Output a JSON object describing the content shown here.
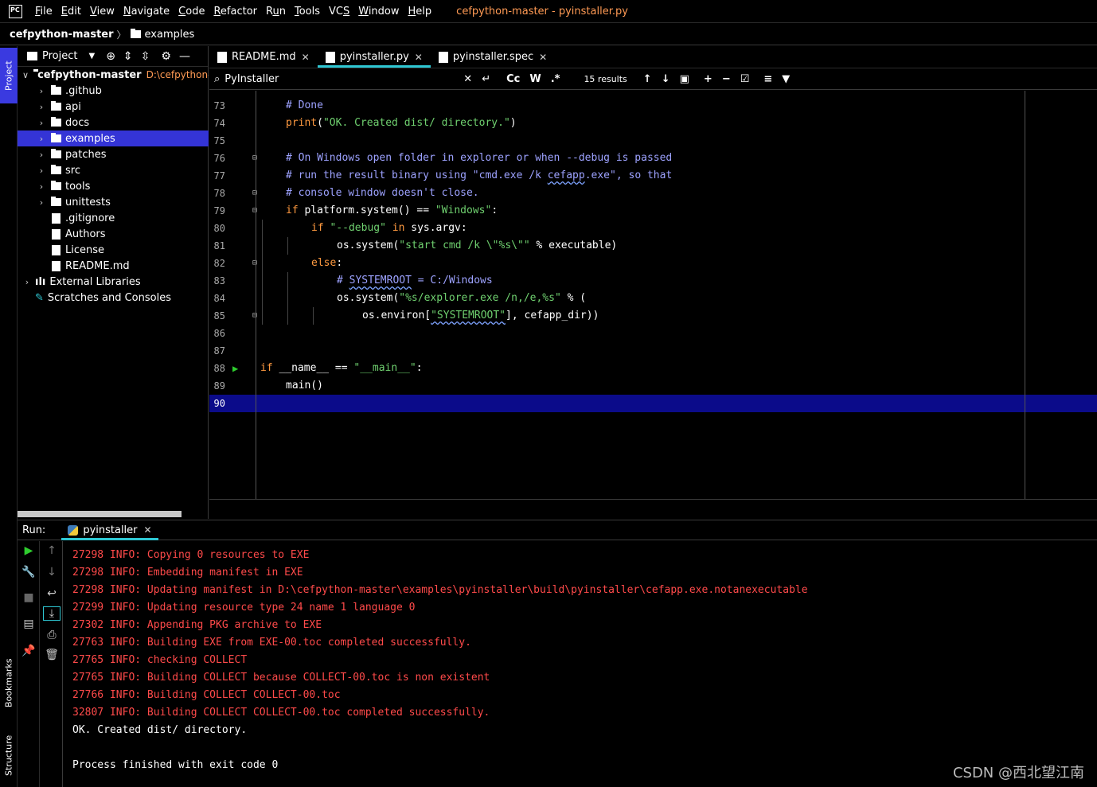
{
  "menubar": {
    "logo": "PC",
    "items": [
      {
        "pre": "",
        "u": "F",
        "post": "ile"
      },
      {
        "pre": "",
        "u": "E",
        "post": "dit"
      },
      {
        "pre": "",
        "u": "V",
        "post": "iew"
      },
      {
        "pre": "",
        "u": "N",
        "post": "avigate"
      },
      {
        "pre": "",
        "u": "C",
        "post": "ode"
      },
      {
        "pre": "",
        "u": "R",
        "post": "efactor"
      },
      {
        "pre": "R",
        "u": "u",
        "post": "n"
      },
      {
        "pre": "",
        "u": "T",
        "post": "ools"
      },
      {
        "pre": "VC",
        "u": "S",
        "post": ""
      },
      {
        "pre": "",
        "u": "W",
        "post": "indow"
      },
      {
        "pre": "",
        "u": "H",
        "post": "elp"
      }
    ],
    "window_title": "cefpython-master - pyinstaller.py"
  },
  "breadcrumb": {
    "root": "cefpython-master",
    "sep": "〉",
    "folder": "examples"
  },
  "left_strip": {
    "project_tab": "Project",
    "bookmarks_tab": "Bookmarks",
    "structure_tab": "Structure"
  },
  "project": {
    "label": "Project",
    "tree": [
      {
        "label": "cefpython-master",
        "path": "D:\\cefpython-m",
        "indent": 0,
        "chev": "∨",
        "type": "folder",
        "bold": true
      },
      {
        "label": ".github",
        "indent": 1,
        "chev": "›",
        "type": "folder"
      },
      {
        "label": "api",
        "indent": 1,
        "chev": "›",
        "type": "folder"
      },
      {
        "label": "docs",
        "indent": 1,
        "chev": "›",
        "type": "folder"
      },
      {
        "label": "examples",
        "indent": 1,
        "chev": "›",
        "type": "folder",
        "selected": true
      },
      {
        "label": "patches",
        "indent": 1,
        "chev": "›",
        "type": "folder"
      },
      {
        "label": "src",
        "indent": 1,
        "chev": "›",
        "type": "folder"
      },
      {
        "label": "tools",
        "indent": 1,
        "chev": "›",
        "type": "folder"
      },
      {
        "label": "unittests",
        "indent": 1,
        "chev": "›",
        "type": "folder"
      },
      {
        "label": ".gitignore",
        "indent": 1,
        "chev": "",
        "type": "file"
      },
      {
        "label": "Authors",
        "indent": 1,
        "chev": "",
        "type": "file"
      },
      {
        "label": "License",
        "indent": 1,
        "chev": "",
        "type": "file"
      },
      {
        "label": "README.md",
        "indent": 1,
        "chev": "",
        "type": "file"
      },
      {
        "label": "External Libraries",
        "indent": 0,
        "chev": "›",
        "type": "lib"
      },
      {
        "label": "Scratches and Consoles",
        "indent": 0,
        "chev": "",
        "type": "scratch"
      }
    ]
  },
  "tabs": [
    {
      "label": "README.md",
      "active": false
    },
    {
      "label": "pyinstaller.py",
      "active": true
    },
    {
      "label": "pyinstaller.spec",
      "active": false
    }
  ],
  "find": {
    "query": "PyInstaller",
    "case_label": "Cc",
    "word_label": "W",
    "regex_label": ".*",
    "results": "15 results"
  },
  "editor": {
    "current_line": "90",
    "lines": [
      {
        "n": "73",
        "indent": 1,
        "parts": [
          [
            "cm",
            "# Done"
          ]
        ]
      },
      {
        "n": "74",
        "indent": 1,
        "parts": [
          [
            "kw",
            "print"
          ],
          [
            "fn",
            "("
          ],
          [
            "str",
            "\"OK. Created dist/ directory.\""
          ],
          [
            "fn",
            ")"
          ]
        ]
      },
      {
        "n": "75",
        "indent": 0,
        "parts": []
      },
      {
        "n": "76",
        "indent": 1,
        "fold": "⌃",
        "parts": [
          [
            "cm",
            "# On Windows open folder in explorer or when --debug is passed"
          ]
        ]
      },
      {
        "n": "77",
        "indent": 1,
        "parts": [
          [
            "cm",
            "# run the result binary using \"cmd.exe /k "
          ],
          [
            "cmw",
            "cefapp"
          ],
          [
            "cm",
            ".exe\", so that"
          ]
        ]
      },
      {
        "n": "78",
        "indent": 1,
        "fold": "⌄",
        "parts": [
          [
            "cm",
            "# console window doesn't close."
          ]
        ]
      },
      {
        "n": "79",
        "indent": 1,
        "fold": "⌃",
        "parts": [
          [
            "kw",
            "if "
          ],
          [
            "fn",
            "platform.system() == "
          ],
          [
            "str",
            "\"Windows\""
          ],
          [
            "fn",
            ":"
          ]
        ]
      },
      {
        "n": "80",
        "indent": 2,
        "parts": [
          [
            "kw",
            "if "
          ],
          [
            "str",
            "\"--debug\""
          ],
          [
            "kw",
            " in "
          ],
          [
            "fn",
            "sys.argv:"
          ]
        ]
      },
      {
        "n": "81",
        "indent": 3,
        "parts": [
          [
            "fn",
            "os.system("
          ],
          [
            "str",
            "\"start cmd /k \\\"%s\\\"\""
          ],
          [
            "fn",
            " % executable)"
          ]
        ]
      },
      {
        "n": "82",
        "indent": 2,
        "fold": "⌃",
        "parts": [
          [
            "kw",
            "else"
          ],
          [
            "fn",
            ":"
          ]
        ]
      },
      {
        "n": "83",
        "indent": 3,
        "parts": [
          [
            "cm",
            "# "
          ],
          [
            "cmw",
            "SYSTEMROOT"
          ],
          [
            "cm",
            " = C:/Windows"
          ]
        ]
      },
      {
        "n": "84",
        "indent": 3,
        "parts": [
          [
            "fn",
            "os.system("
          ],
          [
            "str",
            "\"%s/explorer.exe /n,/e,%s\""
          ],
          [
            "fn",
            " % ("
          ]
        ]
      },
      {
        "n": "85",
        "indent": 4,
        "fold": "⌄",
        "parts": [
          [
            "fn",
            "os.environ["
          ],
          [
            "strw",
            "\"SYSTEMROOT\""
          ],
          [
            "fn",
            "], cefapp_dir))"
          ]
        ]
      },
      {
        "n": "86",
        "indent": 0,
        "parts": []
      },
      {
        "n": "87",
        "indent": 0,
        "parts": []
      },
      {
        "n": "88",
        "indent": 0,
        "run": true,
        "parts": [
          [
            "kw",
            "if "
          ],
          [
            "fn",
            "__name__ == "
          ],
          [
            "str",
            "\"__main__\""
          ],
          [
            "fn",
            ":"
          ]
        ]
      },
      {
        "n": "89",
        "indent": 1,
        "parts": [
          [
            "fn",
            "main()"
          ]
        ]
      },
      {
        "n": "90",
        "indent": 0,
        "parts": []
      }
    ]
  },
  "run": {
    "label": "Run:",
    "tab": "pyinstaller",
    "console": [
      {
        "kind": "err",
        "text": "27298 INFO: Copying 0 resources to EXE"
      },
      {
        "kind": "err",
        "text": "27298 INFO: Embedding manifest in EXE"
      },
      {
        "kind": "err",
        "text": "27298 INFO: Updating manifest in D:\\cefpython-master\\examples\\pyinstaller\\build\\pyinstaller\\cefapp.exe.notanexecutable"
      },
      {
        "kind": "err",
        "text": "27299 INFO: Updating resource type 24 name 1 language 0"
      },
      {
        "kind": "err",
        "text": "27302 INFO: Appending PKG archive to EXE"
      },
      {
        "kind": "err",
        "text": "27763 INFO: Building EXE from EXE-00.toc completed successfully."
      },
      {
        "kind": "err",
        "text": "27765 INFO: checking COLLECT"
      },
      {
        "kind": "err",
        "text": "27765 INFO: Building COLLECT because COLLECT-00.toc is non existent"
      },
      {
        "kind": "err",
        "text": "27766 INFO: Building COLLECT COLLECT-00.toc"
      },
      {
        "kind": "err",
        "text": "32807 INFO: Building COLLECT COLLECT-00.toc completed successfully."
      },
      {
        "kind": "out",
        "text": "OK. Created dist/ directory."
      },
      {
        "kind": "out",
        "text": ""
      },
      {
        "kind": "out",
        "text": "Process finished with exit code 0"
      }
    ]
  },
  "watermark": "CSDN @西北望江南",
  "colors": {
    "accent": "#2ec7d3",
    "selection": "#3434d6",
    "current_line": "#0b0b8a",
    "keyword": "#ff9a40",
    "comment": "#9da2ff",
    "string": "#6fd06f",
    "console_error": "#ff4a4a",
    "title": "#ff9a54"
  }
}
